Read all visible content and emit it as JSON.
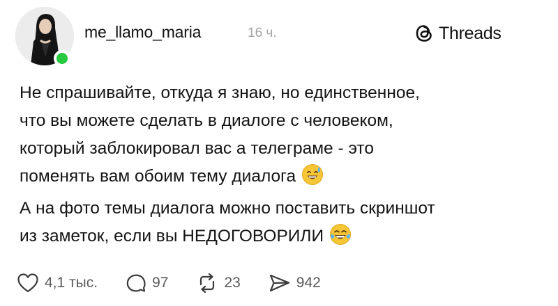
{
  "post": {
    "username": "me_llamo_maria",
    "time": "16 ч.",
    "brand": "Threads",
    "paragraphs": [
      {
        "lines": [
          "Не спрашивайте, откуда я знаю, но единственное,",
          "что вы можете сделать в диалоге с человеком,",
          "который заблокировал вас а телеграме - это",
          "поменять вам обоим тему диалога"
        ],
        "emoji": "sweat-smile-emoji"
      },
      {
        "lines": [
          "А на фото темы диалога можно поставить скриншот",
          "из заметок, если вы НЕДОГОВОРИЛИ"
        ],
        "emoji": "tears-of-joy-emoji"
      }
    ]
  },
  "actions": {
    "likes": "4,1 тыс.",
    "comments": "97",
    "reposts": "23",
    "shares": "942"
  },
  "icons": {
    "like": "heart-icon",
    "comment": "comment-bubble-icon",
    "repost": "repost-icon",
    "share": "send-icon",
    "brand": "threads-logo-icon"
  },
  "colors": {
    "online": "#27c93f",
    "muted": "#a4a4a4",
    "text": "#141414"
  }
}
